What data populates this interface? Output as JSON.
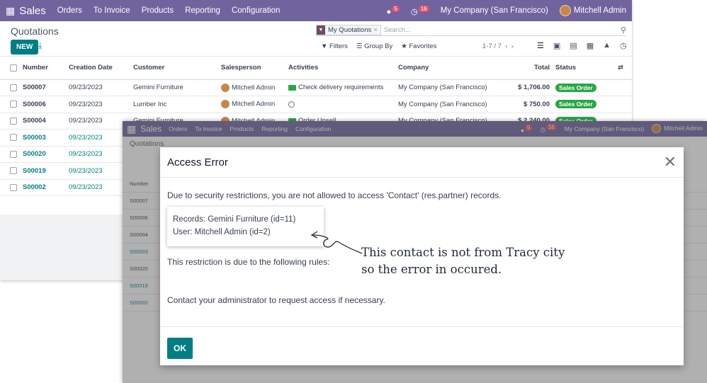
{
  "top": {
    "app_name": "Sales",
    "menus": [
      "Orders",
      "To Invoice",
      "Products",
      "Reporting",
      "Configuration"
    ],
    "chat_count": "5",
    "activity_count": "16",
    "company": "My Company (San Francisco)",
    "user": "Mitchell Admin"
  },
  "control": {
    "title": "Quotations",
    "new_label": "NEW",
    "facet": "My Quotations",
    "search_placeholder": "Search...",
    "filters": "Filters",
    "group_by": "Group By",
    "favorites": "Favorites",
    "pager": "1-7 / 7"
  },
  "table": {
    "headers": [
      "Number",
      "Creation Date",
      "Customer",
      "Salesperson",
      "Activities",
      "Company",
      "Total",
      "Status"
    ],
    "rows": [
      {
        "number": "S00007",
        "date": "09/23/2023",
        "customer": "Gemini Furniture",
        "salesperson": "Mitchell Admin",
        "activity": "Check delivery requirements",
        "company": "My Company (San Francisco)",
        "total": "$ 1,706.00",
        "status": "Sales Order"
      },
      {
        "number": "S00006",
        "date": "09/23/2023",
        "customer": "Lumber Inc",
        "salesperson": "Mitchell Admin",
        "activity": "",
        "company": "My Company (San Francisco)",
        "total": "$ 750.00",
        "status": "Sales Order"
      },
      {
        "number": "S00004",
        "date": "09/23/2023",
        "customer": "Gemini Furniture",
        "salesperson": "Mitchell Admin",
        "activity": "Order Upsell",
        "company": "My Company (San Francisco)",
        "total": "$ 2,240.00",
        "status": "Sales Order"
      },
      {
        "number": "S00003",
        "date": "09/23/2023"
      },
      {
        "number": "S00020",
        "date": "09/23/2023"
      },
      {
        "number": "S00019",
        "date": "09/23/2023"
      },
      {
        "number": "S00002",
        "date": "09/23/2023"
      }
    ]
  },
  "modal": {
    "title": "Access Error",
    "message": "Due to security restrictions, you are not allowed to access 'Contact' (res.partner) records.",
    "records_line": "Records: Gemini Furniture (id=11)",
    "user_line": "User: Mitchell Admin (id=2)",
    "restriction": "This restriction is due to the following rules:",
    "contact_admin": "Contact your administrator to request access if necessary.",
    "ok_label": "OK"
  },
  "annotation": {
    "line1": "This contact is not from Tracy city",
    "line2": "so the error in occured."
  }
}
